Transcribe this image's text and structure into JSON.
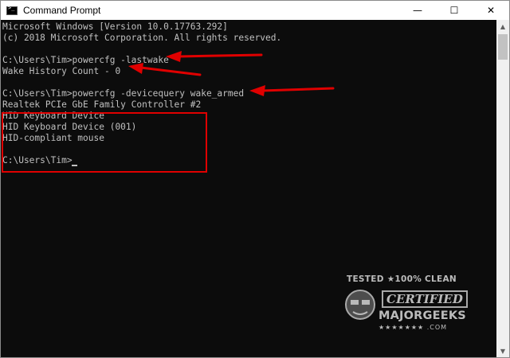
{
  "window": {
    "title": "Command Prompt",
    "minimize_glyph": "—",
    "maximize_glyph": "☐",
    "close_glyph": "✕"
  },
  "console": {
    "lines": [
      "Microsoft Windows [Version 10.0.17763.292]",
      "(c) 2018 Microsoft Corporation. All rights reserved.",
      "",
      "C:\\Users\\Tim>powercfg -lastwake",
      "Wake History Count - 0",
      "",
      "C:\\Users\\Tim>powercfg -devicequery wake_armed",
      "Realtek PCIe GbE Family Controller #2",
      "HID Keyboard Device",
      "HID Keyboard Device (001)",
      "HID-compliant mouse",
      "",
      "C:\\Users\\Tim>"
    ]
  },
  "annotations": {
    "color": "#e00000"
  },
  "watermark": {
    "top": "TESTED ★100% CLEAN",
    "certified": "CERTIFIED",
    "brand": "MAJORGEEKS",
    "com": "★★★★★★★ .COM"
  },
  "colors": {
    "console_bg": "#0c0c0c",
    "console_text": "#c0c0c0",
    "titlebar_bg": "#ffffff"
  }
}
